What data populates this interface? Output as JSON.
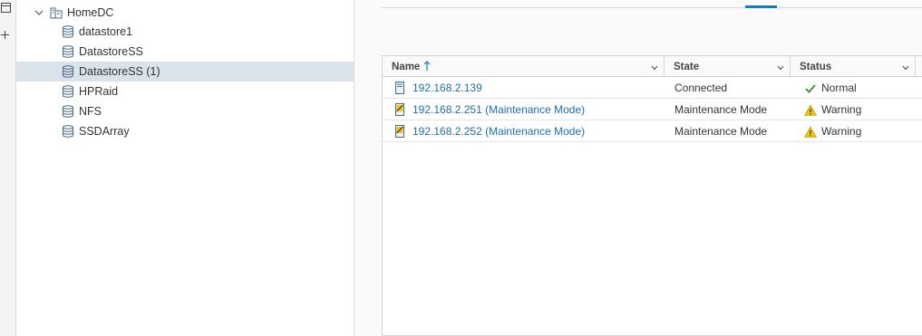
{
  "navigator": {
    "root": {
      "label": "HomeDC",
      "icon": "datacenter-icon",
      "expanded": true
    },
    "items": [
      {
        "label": "datastore1",
        "icon": "datastore-icon",
        "selected": false
      },
      {
        "label": "DatastoreSS",
        "icon": "datastore-icon",
        "selected": false
      },
      {
        "label": "DatastoreSS (1)",
        "icon": "datastore-icon",
        "selected": true
      },
      {
        "label": "HPRaid",
        "icon": "datastore-icon",
        "selected": false
      },
      {
        "label": "NFS",
        "icon": "datastore-icon",
        "selected": false
      },
      {
        "label": "SSDArray",
        "icon": "datastore-icon",
        "selected": false
      }
    ]
  },
  "grid": {
    "columns": [
      {
        "label": "Name",
        "sorted": "ascending"
      },
      {
        "label": "State"
      },
      {
        "label": "Status"
      }
    ],
    "rows": [
      {
        "name": "192.168.2.139",
        "state": "Connected",
        "status": "Normal",
        "host_icon": "host-icon",
        "status_icon": "check-icon"
      },
      {
        "name": "192.168.2.251 (Maintenance Mode)",
        "state": "Maintenance Mode",
        "status": "Warning",
        "host_icon": "host-maintenance-icon",
        "status_icon": "warning-icon"
      },
      {
        "name": "192.168.2.252 (Maintenance Mode)",
        "state": "Maintenance Mode",
        "status": "Warning",
        "host_icon": "host-maintenance-icon",
        "status_icon": "warning-icon"
      }
    ]
  },
  "colors": {
    "link": "#1d6fb0",
    "selection": "#dbe3ea",
    "ok": "#3c8d2f",
    "warning": "#f2c500"
  }
}
